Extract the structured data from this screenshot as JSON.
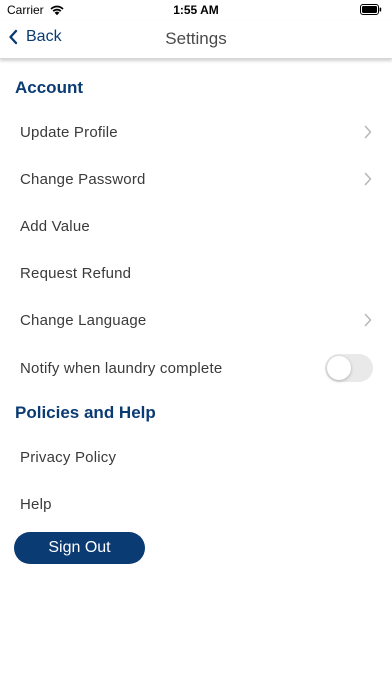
{
  "status_bar": {
    "carrier": "Carrier",
    "time": "1:55 AM",
    "icons": [
      "wifi-icon",
      "battery-icon"
    ]
  },
  "nav": {
    "back_label": "Back",
    "title": "Settings"
  },
  "sections": {
    "account": {
      "header": "Account",
      "items": [
        {
          "label": "Update Profile",
          "chevron": true
        },
        {
          "label": "Change Password",
          "chevron": true
        },
        {
          "label": "Add Value",
          "chevron": false
        },
        {
          "label": "Request Refund",
          "chevron": false
        },
        {
          "label": "Change Language",
          "chevron": true
        },
        {
          "label": "Notify when laundry complete",
          "toggle": true,
          "toggle_on": false
        }
      ]
    },
    "policies": {
      "header": "Policies and Help",
      "items": [
        {
          "label": "Privacy Policy"
        },
        {
          "label": "Help"
        }
      ]
    }
  },
  "actions": {
    "sign_out_label": "Sign Out"
  },
  "colors": {
    "accent": "#0b3b73",
    "text": "#3a3a3a",
    "chevron": "#b8b8bd",
    "toggle_off": "#e9e9ea"
  }
}
